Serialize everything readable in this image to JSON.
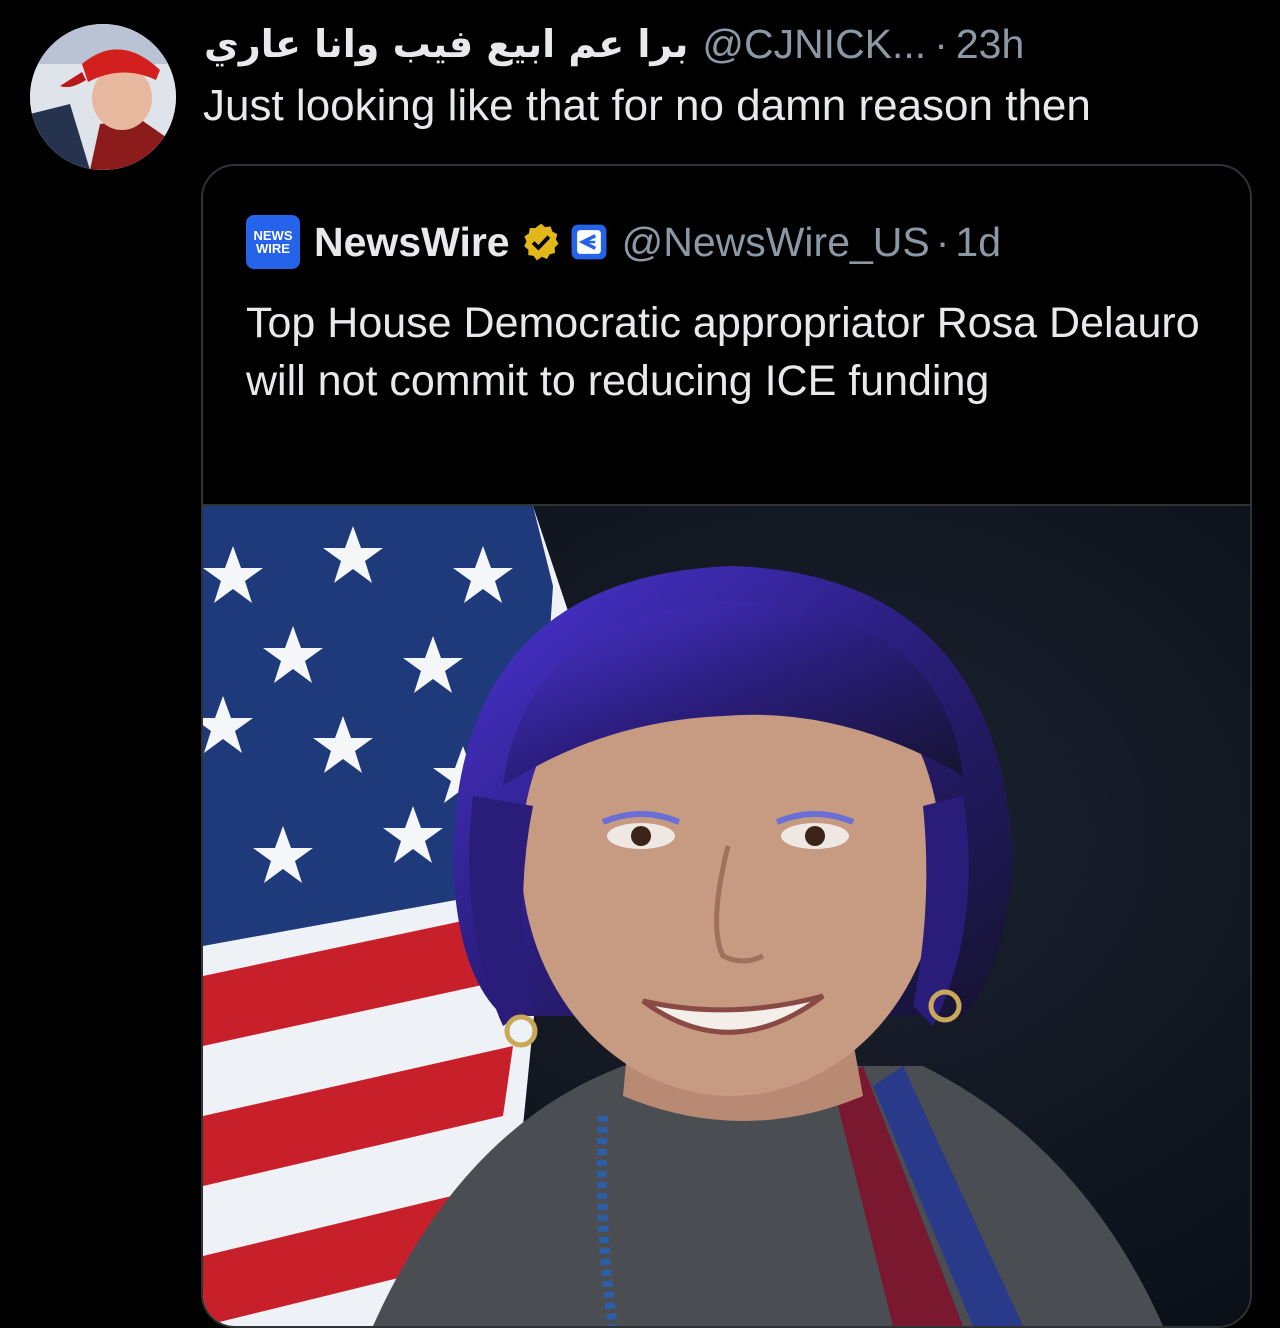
{
  "tweet": {
    "display_name": "برا عم ابيع فيب وانا عاري",
    "handle": "@CJNICK...",
    "separator": "·",
    "time": "23h",
    "text": "Just looking like that for no damn reason then",
    "avatar_icon": "profile-photo"
  },
  "quote": {
    "logo_text_1": "NEWS",
    "logo_text_2": "WIRE",
    "name": "NewsWire",
    "handle": "@NewsWire_US",
    "separator": "·",
    "time": "1d",
    "text": "Top House Democratic appropriator Rosa Delauro will not commit to reducing ICE funding",
    "verified_icon": "verified-badge-gold",
    "affiliate_icon": "affiliate-badge",
    "photo_icon": "portrait-photo"
  },
  "colors": {
    "background": "#000000",
    "text_primary": "#e7e9ea",
    "text_secondary": "#8b98a5",
    "border": "#2f3336",
    "verified_gold": "#e2b719",
    "logo_blue": "#2563eb"
  }
}
